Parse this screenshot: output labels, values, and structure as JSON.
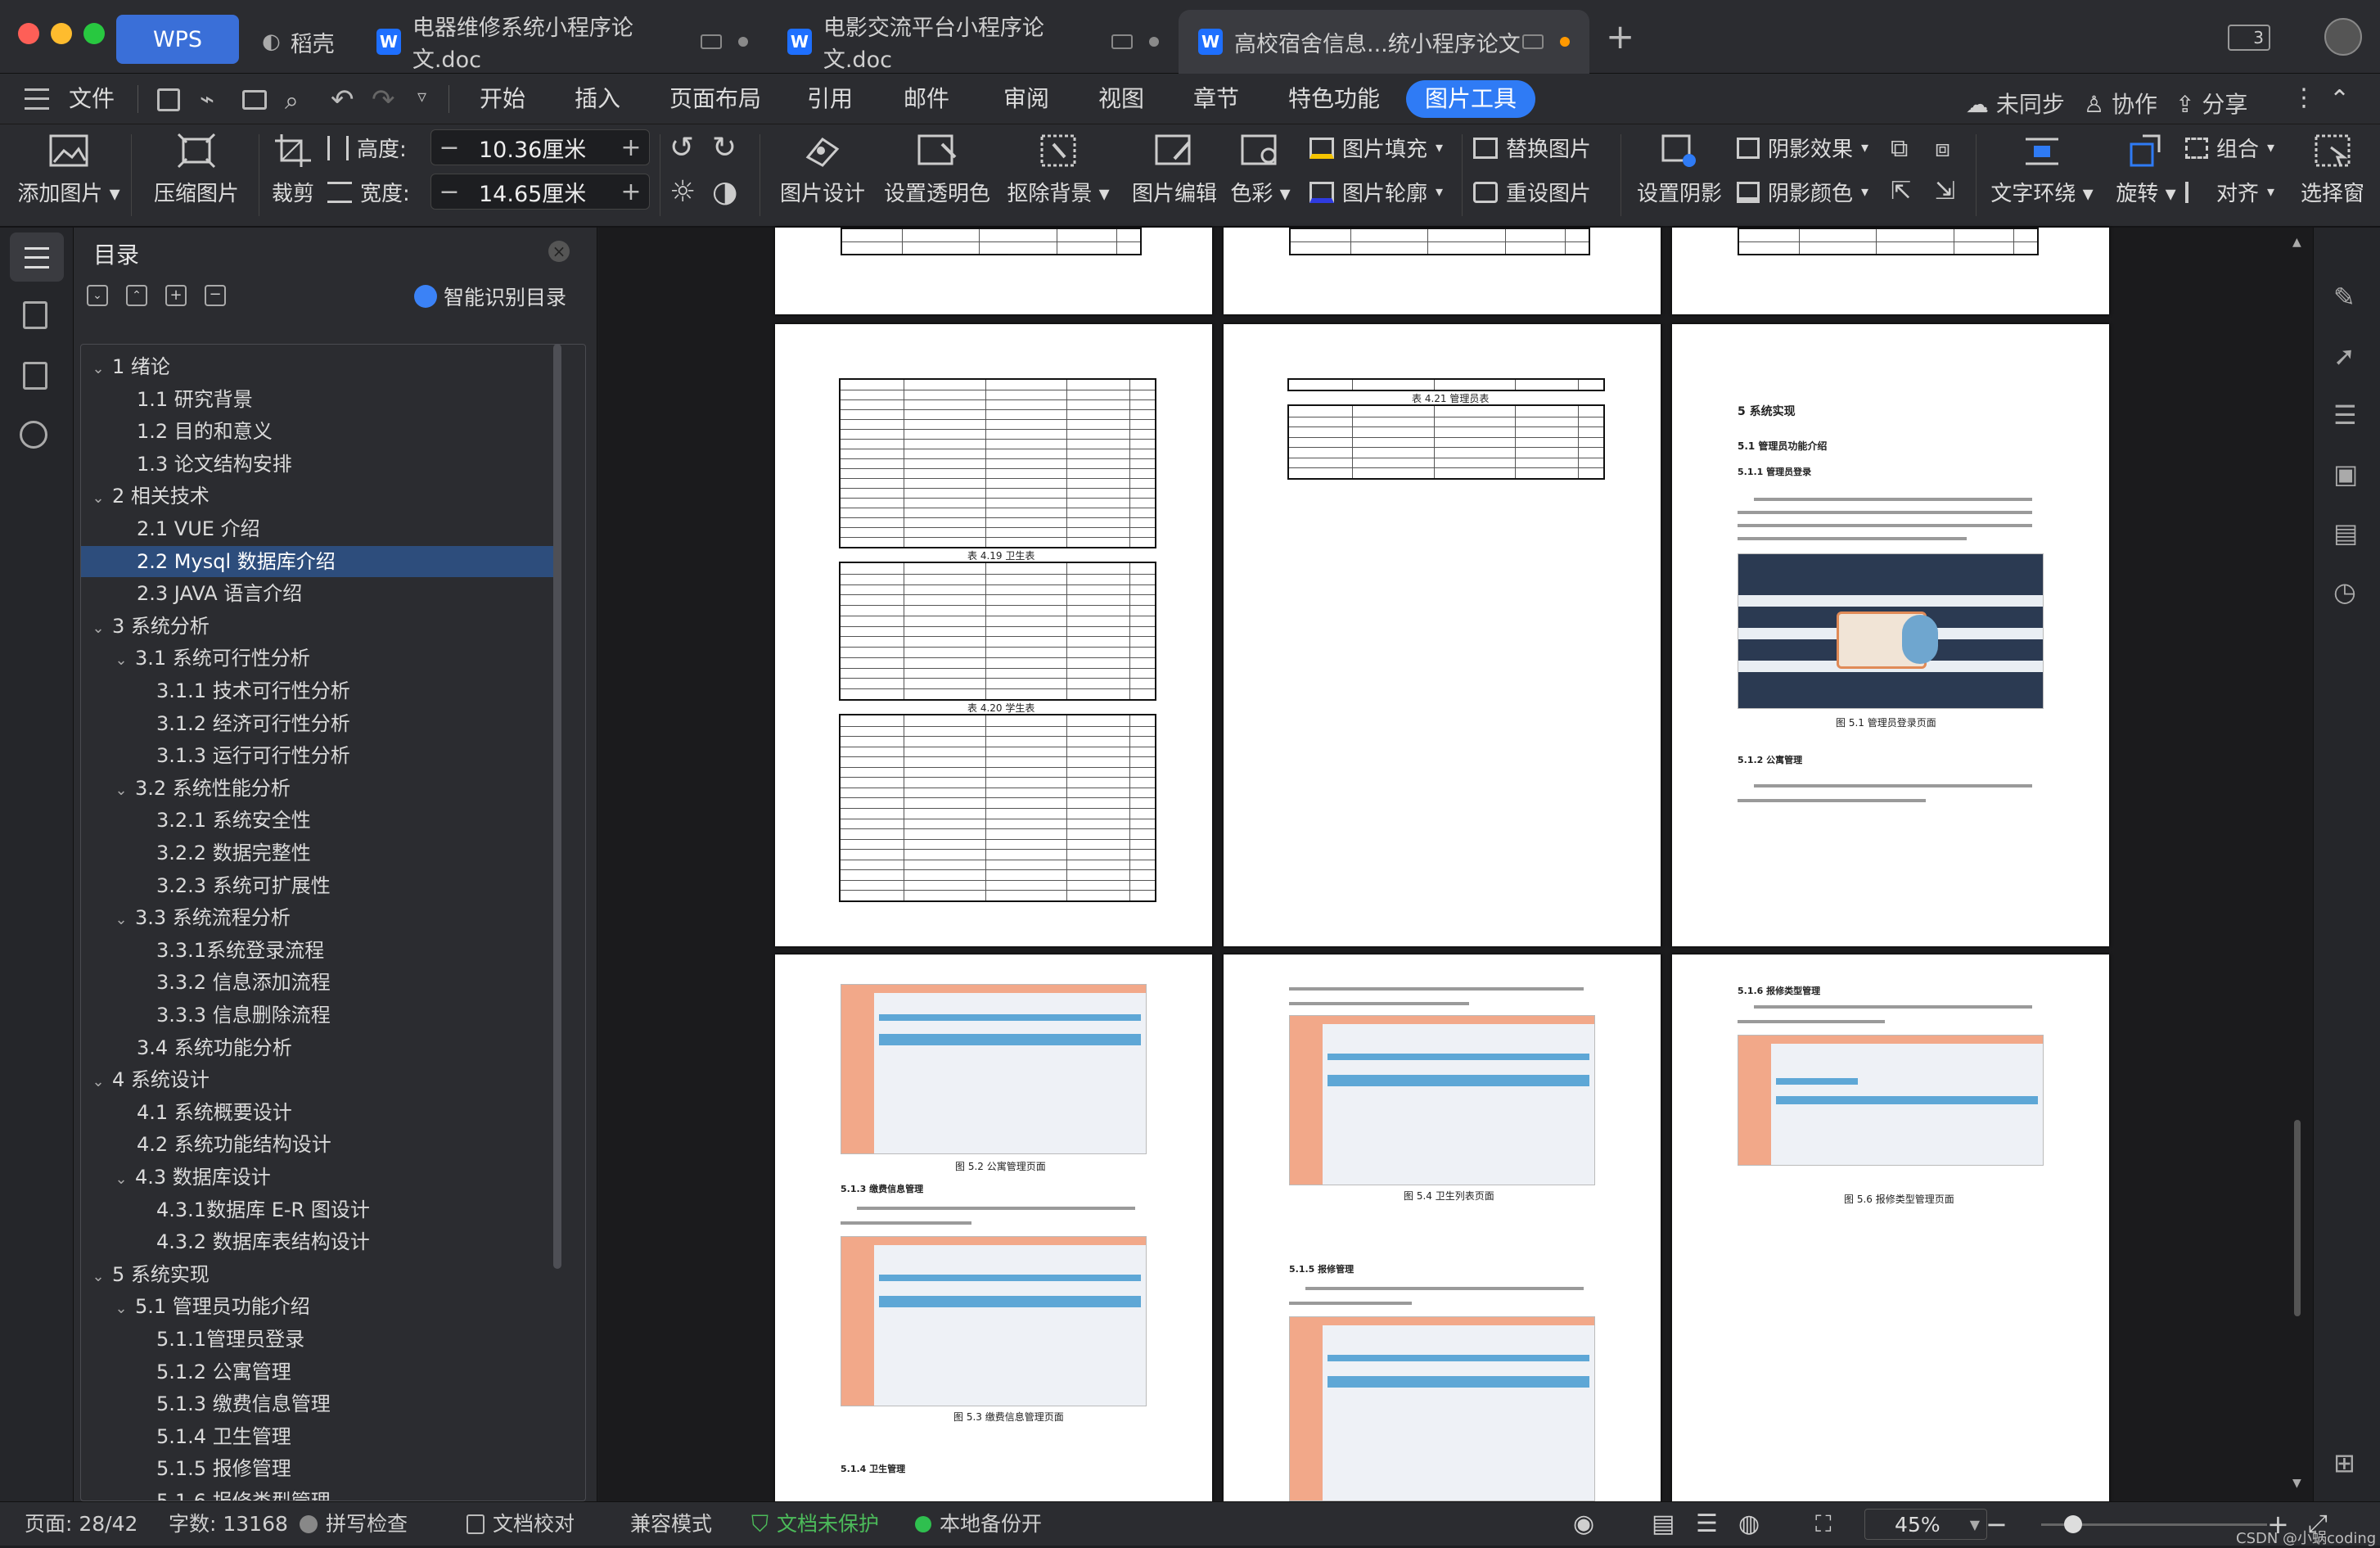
{
  "tabs": [
    {
      "label": "WPS"
    },
    {
      "label": "稻壳"
    },
    {
      "label": "电器维修系统小程序论文.doc"
    },
    {
      "label": "电影交流平台小程序论文.doc"
    },
    {
      "label": "高校宿舍信息...统小程序论文"
    }
  ],
  "window_badge": "3",
  "menubar": {
    "file": "文件",
    "items": [
      "开始",
      "插入",
      "页面布局",
      "引用",
      "邮件",
      "审阅",
      "视图",
      "章节",
      "特色功能",
      "图片工具"
    ],
    "active": "图片工具",
    "sync": "未同步",
    "collab": "协作",
    "share": "分享"
  },
  "ribbon": {
    "add_picture": "添加图片",
    "compress": "压缩图片",
    "crop": "裁剪",
    "height_label": "高度:",
    "height_value": "10.36厘米",
    "width_label": "宽度:",
    "width_value": "14.65厘米",
    "picture_design": "图片设计",
    "set_transparent": "设置透明色",
    "remove_background": "抠除背景",
    "picture_edit": "图片编辑",
    "color": "色彩",
    "picture_fill": "图片填充",
    "picture_outline": "图片轮廓",
    "replace_picture": "替换图片",
    "reset_picture": "重设图片",
    "set_shadow": "设置阴影",
    "shadow_effect": "阴影效果",
    "shadow_color": "阴影颜色",
    "text_wrap": "文字环绕",
    "rotate": "旋转",
    "group": "组合",
    "align": "对齐",
    "selection_pane": "选择窗"
  },
  "toc": {
    "title": "目录",
    "smart_toc": "智能识别目录",
    "items": [
      {
        "label": "1  绪论",
        "level": 0,
        "chevron": true
      },
      {
        "label": "1.1  研究背景",
        "level": 1
      },
      {
        "label": "1.2 目的和意义",
        "level": 1
      },
      {
        "label": "1.3  论文结构安排",
        "level": 1
      },
      {
        "label": "2  相关技术",
        "level": 0,
        "chevron": true
      },
      {
        "label": "2.1 VUE 介绍",
        "level": 1
      },
      {
        "label": "2.2 Mysql 数据库介绍",
        "level": 1,
        "selected": true
      },
      {
        "label": "2.3 JAVA 语言介绍",
        "level": 1
      },
      {
        "label": "3  系统分析",
        "level": 0,
        "chevron": true
      },
      {
        "label": "3.1 系统可行性分析",
        "level": 1,
        "chevron": true
      },
      {
        "label": "3.1.1  技术可行性分析",
        "level": 2
      },
      {
        "label": "3.1.2  经济可行性分析",
        "level": 2
      },
      {
        "label": "3.1.3  运行可行性分析",
        "level": 2
      },
      {
        "label": "3.2 系统性能分析",
        "level": 1,
        "chevron": true
      },
      {
        "label": "3.2.1  系统安全性",
        "level": 2
      },
      {
        "label": "3.2.2  数据完整性",
        "level": 2
      },
      {
        "label": "3.2.3 系统可扩展性",
        "level": 2
      },
      {
        "label": "3.3 系统流程分析",
        "level": 1,
        "chevron": true
      },
      {
        "label": "3.3.1系统登录流程",
        "level": 2
      },
      {
        "label": "3.3.2 信息添加流程",
        "level": 2
      },
      {
        "label": "3.3.3 信息删除流程",
        "level": 2
      },
      {
        "label": "3.4 系统功能分析",
        "level": 1
      },
      {
        "label": "4  系统设计",
        "level": 0,
        "chevron": true
      },
      {
        "label": "4.1 系统概要设计",
        "level": 1
      },
      {
        "label": "4.2 系统功能结构设计",
        "level": 1
      },
      {
        "label": "4.3 数据库设计",
        "level": 1,
        "chevron": true
      },
      {
        "label": "4.3.1数据库 E-R 图设计",
        "level": 2
      },
      {
        "label": "4.3.2  数据库表结构设计",
        "level": 2
      },
      {
        "label": "5  系统实现",
        "level": 0,
        "chevron": true
      },
      {
        "label": "5.1 管理员功能介绍",
        "level": 1,
        "chevron": true
      },
      {
        "label": "5.1.1管理员登录",
        "level": 2
      },
      {
        "label": "5.1.2  公寓管理",
        "level": 2
      },
      {
        "label": "5.1.3  缴费信息管理",
        "level": 2
      },
      {
        "label": "5.1.4 卫生管理",
        "level": 2
      },
      {
        "label": "5.1.5  报修管理",
        "level": 2
      },
      {
        "label": "5.1.6 报修类型管理",
        "level": 2
      }
    ]
  },
  "document": {
    "caption_419": "表 4.19 卫生表",
    "caption_420": "表 4.20 学生表",
    "caption_421": "表 4.21 管理员表",
    "heading_5": "5 系统实现",
    "heading_51": "5.1 管理员功能介绍",
    "heading_511": "5.1.1 管理员登录",
    "heading_512": "5.1.2  公寓管理",
    "fig51": "图 5.1 管理员登录页面",
    "fig52": "图 5.2  公寓管理页面",
    "heading_513": "5.1.3  缴费信息管理",
    "fig53": "图 5.3  缴费信息管理页面",
    "heading_514": "5.1.4 卫生管理",
    "fig54": "图 5.4  卫生列表页面",
    "heading_515": "5.1.5  报修管理",
    "heading_516": "5.1.6  报修类型管理",
    "fig56": "图 5.6  报修类型管理页面"
  },
  "statusbar": {
    "page": "页面: 28/42",
    "words": "字数: 13168",
    "spell": "拼写检查",
    "proof": "文档校对",
    "compat": "兼容模式",
    "protect": "文档未保护",
    "backup": "本地备份开",
    "zoom": "45%",
    "watermark": "CSDN @小蜗coding"
  },
  "colors": {
    "accent": "#1e6fff",
    "active_tab_pill": "#2f7bf5",
    "selected_toc": "#2d4d7c",
    "protect_green": "#4cbb5a",
    "backup_green": "#2fbf4f"
  }
}
